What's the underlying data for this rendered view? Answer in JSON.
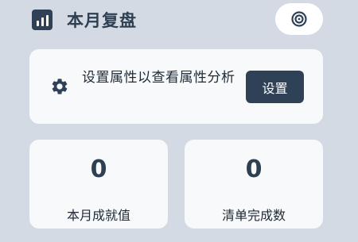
{
  "header": {
    "title": "本月复盘",
    "icon": "bar-chart-icon",
    "action_icon": "target-icon"
  },
  "prompt": {
    "icon": "gear-icon",
    "text": "设置属性以查看属性分析",
    "button_label": "设置"
  },
  "stats": [
    {
      "value": "0",
      "label": "本月成就值"
    },
    {
      "value": "0",
      "label": "清单完成数"
    }
  ],
  "colors": {
    "background": "#d3dae3",
    "card": "#f8f9fb",
    "primary": "#2f4156",
    "text": "#2e3f52"
  }
}
